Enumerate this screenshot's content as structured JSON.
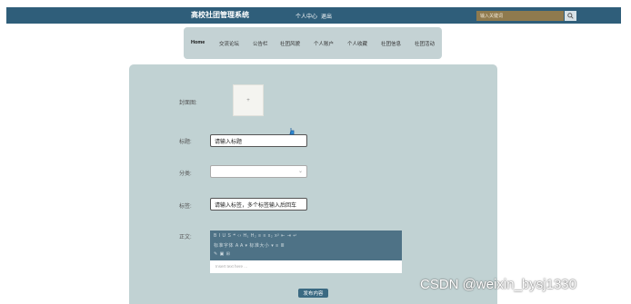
{
  "header": {
    "site_title": "高校社团管理系统",
    "links": [
      "个人中心",
      "退出"
    ],
    "search_placeholder": "输入关键词"
  },
  "nav": {
    "items": [
      "Home",
      "交流论坛",
      "公告栏",
      "社团风貌",
      "个人账户",
      "个人收藏",
      "社团信息",
      "社团活动"
    ],
    "active": "Home"
  },
  "form": {
    "cover_label": "封面图:",
    "cover_placeholder": "+",
    "title_label": "标题:",
    "title_value": "请输入标题",
    "category_label": "分类:",
    "category_value": "",
    "tags_label": "标签:",
    "tags_value": "请输入标签，多个标签输入后回车",
    "content_label": "正文:",
    "toolbar_row1": "B  I  U  S    ❝  ‹›    H₁  H₂    ≡  ≡    x₂  x²    ⇤  ⇥   ↵",
    "toolbar_row2": "标准字体    A    A    ▾    标准大小    ▾    ≡    ≣",
    "toolbar_row3": "✎  ▣  ⊞",
    "editor_placeholder": "Insert text here ...",
    "submit_label": "发布内容"
  },
  "watermark": "CSDN @weixin_bysj1330"
}
